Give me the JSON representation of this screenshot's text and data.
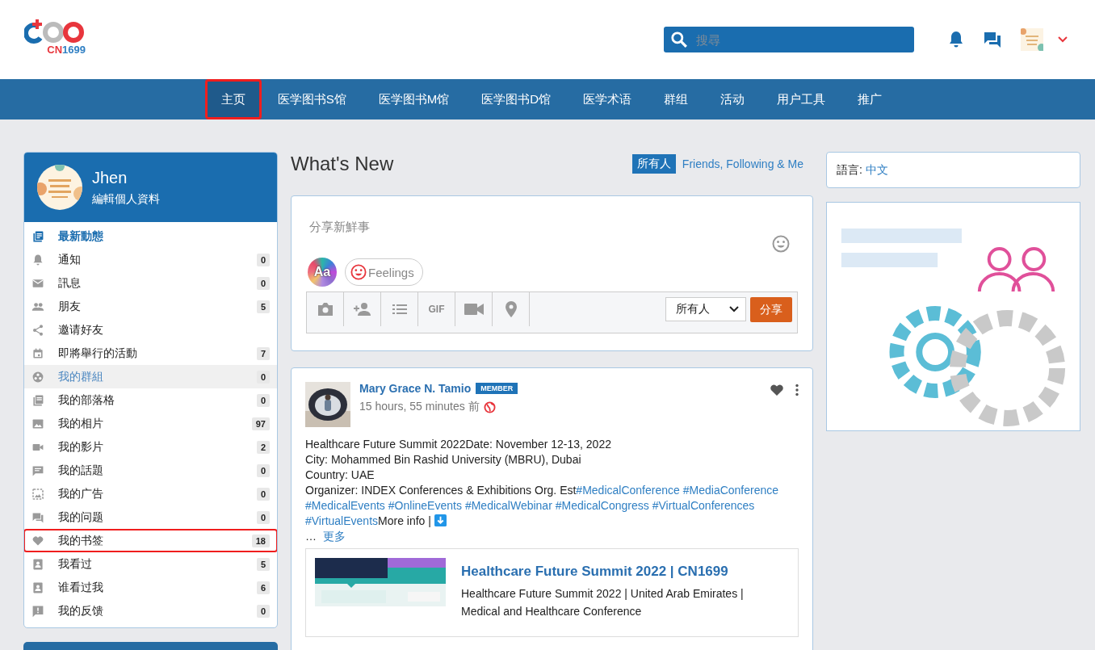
{
  "logo": {
    "parts": [
      {
        "text": "CN",
        "color": "#e8363d"
      },
      {
        "text": "1699",
        "color": "#2f7fc3"
      }
    ]
  },
  "search": {
    "placeholder": "搜尋"
  },
  "nav": [
    {
      "label": "主页",
      "selected": true,
      "highlighted": true
    },
    {
      "label": "医学图书S馆",
      "selected": false,
      "highlighted": false
    },
    {
      "label": "医学图书M馆",
      "selected": false,
      "highlighted": false
    },
    {
      "label": "医学图书D馆",
      "selected": false,
      "highlighted": false
    },
    {
      "label": "医学术语",
      "selected": false,
      "highlighted": false
    },
    {
      "label": "群组",
      "selected": false,
      "highlighted": false
    },
    {
      "label": "活动",
      "selected": false,
      "highlighted": false
    },
    {
      "label": "用户工具",
      "selected": false,
      "highlighted": false
    },
    {
      "label": "推广",
      "selected": false,
      "highlighted": false
    }
  ],
  "profile": {
    "name": "Jhen",
    "edit_link": "編輯個人資料"
  },
  "sidebar": {
    "items": [
      {
        "label": "最新動態",
        "selected": true,
        "hovered": false,
        "highlighted": false
      },
      {
        "label": "通知",
        "count": "0",
        "selected": false,
        "hovered": false,
        "highlighted": false
      },
      {
        "label": "訊息",
        "count": "0",
        "selected": false,
        "hovered": false,
        "highlighted": false
      },
      {
        "label": "朋友",
        "count": "5",
        "selected": false,
        "hovered": false,
        "highlighted": false
      },
      {
        "label": "邀请好友",
        "selected": false,
        "hovered": false,
        "highlighted": false
      },
      {
        "label": "即將舉行的活動",
        "count": "7",
        "selected": false,
        "hovered": false,
        "highlighted": false
      },
      {
        "label": "我的群組",
        "count": "0",
        "selected": false,
        "hovered": true,
        "highlighted": false
      },
      {
        "label": "我的部落格",
        "count": "0",
        "selected": false,
        "hovered": false,
        "highlighted": false
      },
      {
        "label": "我的相片",
        "count": "97",
        "selected": false,
        "hovered": false,
        "highlighted": false
      },
      {
        "label": "我的影片",
        "count": "2",
        "selected": false,
        "hovered": false,
        "highlighted": false
      },
      {
        "label": "我的話題",
        "count": "0",
        "selected": false,
        "hovered": false,
        "highlighted": false
      },
      {
        "label": "我的广告",
        "count": "0",
        "selected": false,
        "hovered": false,
        "highlighted": false
      },
      {
        "label": "我的问题",
        "count": "0",
        "selected": false,
        "hovered": false,
        "highlighted": false
      },
      {
        "label": "我的书签",
        "count": "18",
        "selected": false,
        "hovered": false,
        "highlighted": true
      },
      {
        "label": "我看过",
        "count": "5",
        "selected": false,
        "hovered": false,
        "highlighted": false
      },
      {
        "label": "谁看过我",
        "count": "6",
        "selected": false,
        "hovered": false,
        "highlighted": false
      },
      {
        "label": "我的反馈",
        "count": "0",
        "selected": false,
        "hovered": false,
        "highlighted": false
      }
    ]
  },
  "feed": {
    "title": "What's New",
    "filters": [
      {
        "label": "所有人",
        "selected": true
      },
      {
        "label": "Friends, Following & Me",
        "selected": false
      }
    ]
  },
  "composer": {
    "placeholder": "分享新鮮事",
    "text_style_label": "Aa",
    "feelings_label": "Feelings",
    "gif_label": "GIF",
    "privacy_value": "所有人",
    "submit_label": "分享"
  },
  "post": {
    "author": "Mary Grace N. Tamio",
    "badge": "MEMBER",
    "time": "15 hours, 55 minutes 前",
    "lines": [
      [
        {
          "kind": "text",
          "text": "Healthcare Future Summit 2022Date: November 12-13, 2022"
        }
      ],
      [
        {
          "kind": "text",
          "text": "City: Mohammed Bin Rashid University (MBRU), Dubai"
        }
      ],
      [
        {
          "kind": "text",
          "text": "Country: UAE"
        }
      ],
      [
        {
          "kind": "text",
          "text": "Organizer: INDEX Conferences & Exhibitions Org. Est"
        },
        {
          "kind": "tag",
          "text": "#MedicalConference"
        },
        {
          "kind": "tag",
          "text": "#MediaConference"
        }
      ],
      [
        {
          "kind": "tag",
          "text": "#MedicalEvents"
        },
        {
          "kind": "tag",
          "text": "#OnlineEvents"
        },
        {
          "kind": "tag",
          "text": "#MedicalWebinar"
        },
        {
          "kind": "tag",
          "text": "#MedicalCongress"
        },
        {
          "kind": "tag",
          "text": "#VirtualConferences"
        }
      ],
      [
        {
          "kind": "tag",
          "text": "#VirtualEvents"
        },
        {
          "kind": "text",
          "text": "More info | "
        }
      ]
    ],
    "ellipsis": "…",
    "more_link": "更多",
    "preview": {
      "title": "Healthcare Future Summit 2022 | CN1699",
      "description": "Healthcare Future Summit 2022 | United Arab Emirates | Medical and Healthcare Conference"
    }
  },
  "language": {
    "label": "語言:",
    "value": "中文"
  }
}
